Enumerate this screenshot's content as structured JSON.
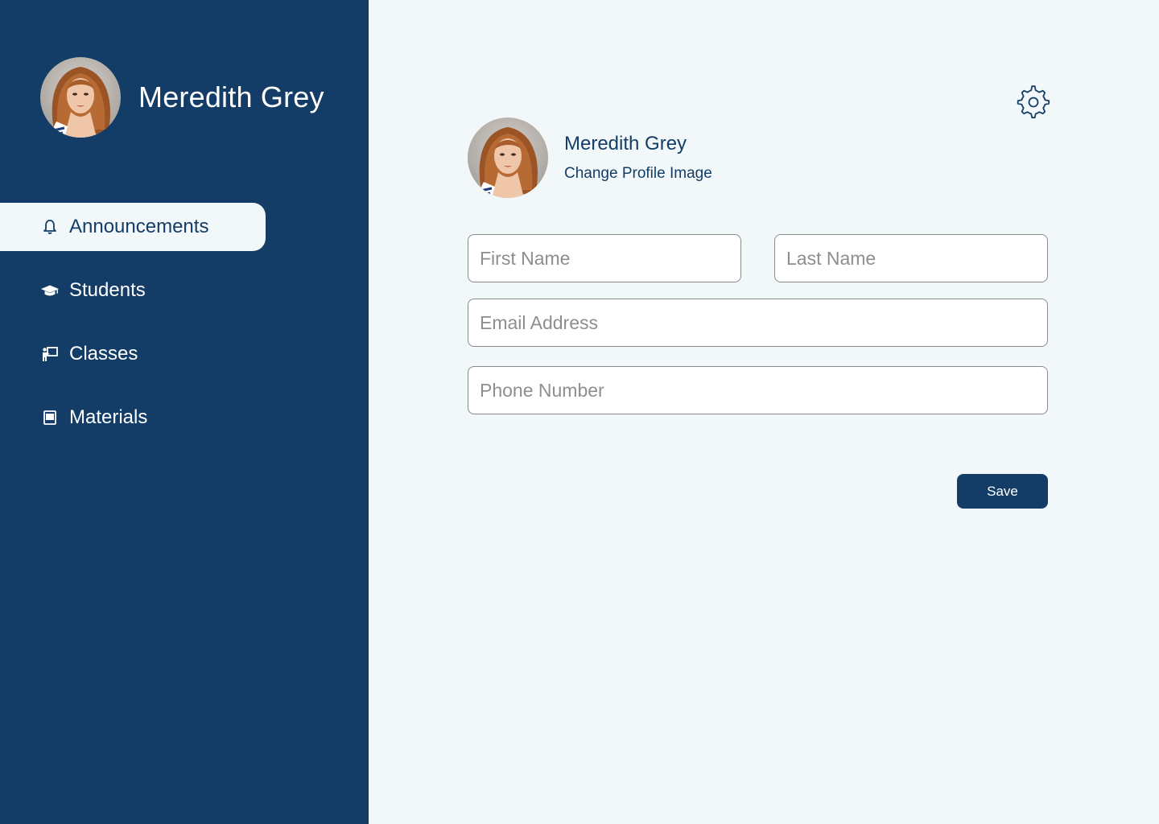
{
  "user": {
    "name": "Meredith Grey"
  },
  "sidebar": {
    "items": [
      {
        "label": "Announcements",
        "icon": "bell-icon",
        "active": true
      },
      {
        "label": "Students",
        "icon": "graduation-cap-icon",
        "active": false
      },
      {
        "label": "Classes",
        "icon": "presentation-board-icon",
        "active": false
      },
      {
        "label": "Materials",
        "icon": "book-icon",
        "active": false
      }
    ]
  },
  "profile": {
    "name": "Meredith Grey",
    "change_image_label": "Change Profile Image"
  },
  "form": {
    "first_name": {
      "value": "",
      "placeholder": "First Name"
    },
    "last_name": {
      "value": "",
      "placeholder": "Last Name"
    },
    "email": {
      "value": "",
      "placeholder": "Email Address"
    },
    "phone": {
      "value": "",
      "placeholder": "Phone Number"
    }
  },
  "actions": {
    "save_label": "Save"
  },
  "icons": {
    "settings": "gear-icon"
  },
  "colors": {
    "primary": "#133D66",
    "background": "#F2F7FA",
    "input_border": "#8A8A8A"
  }
}
